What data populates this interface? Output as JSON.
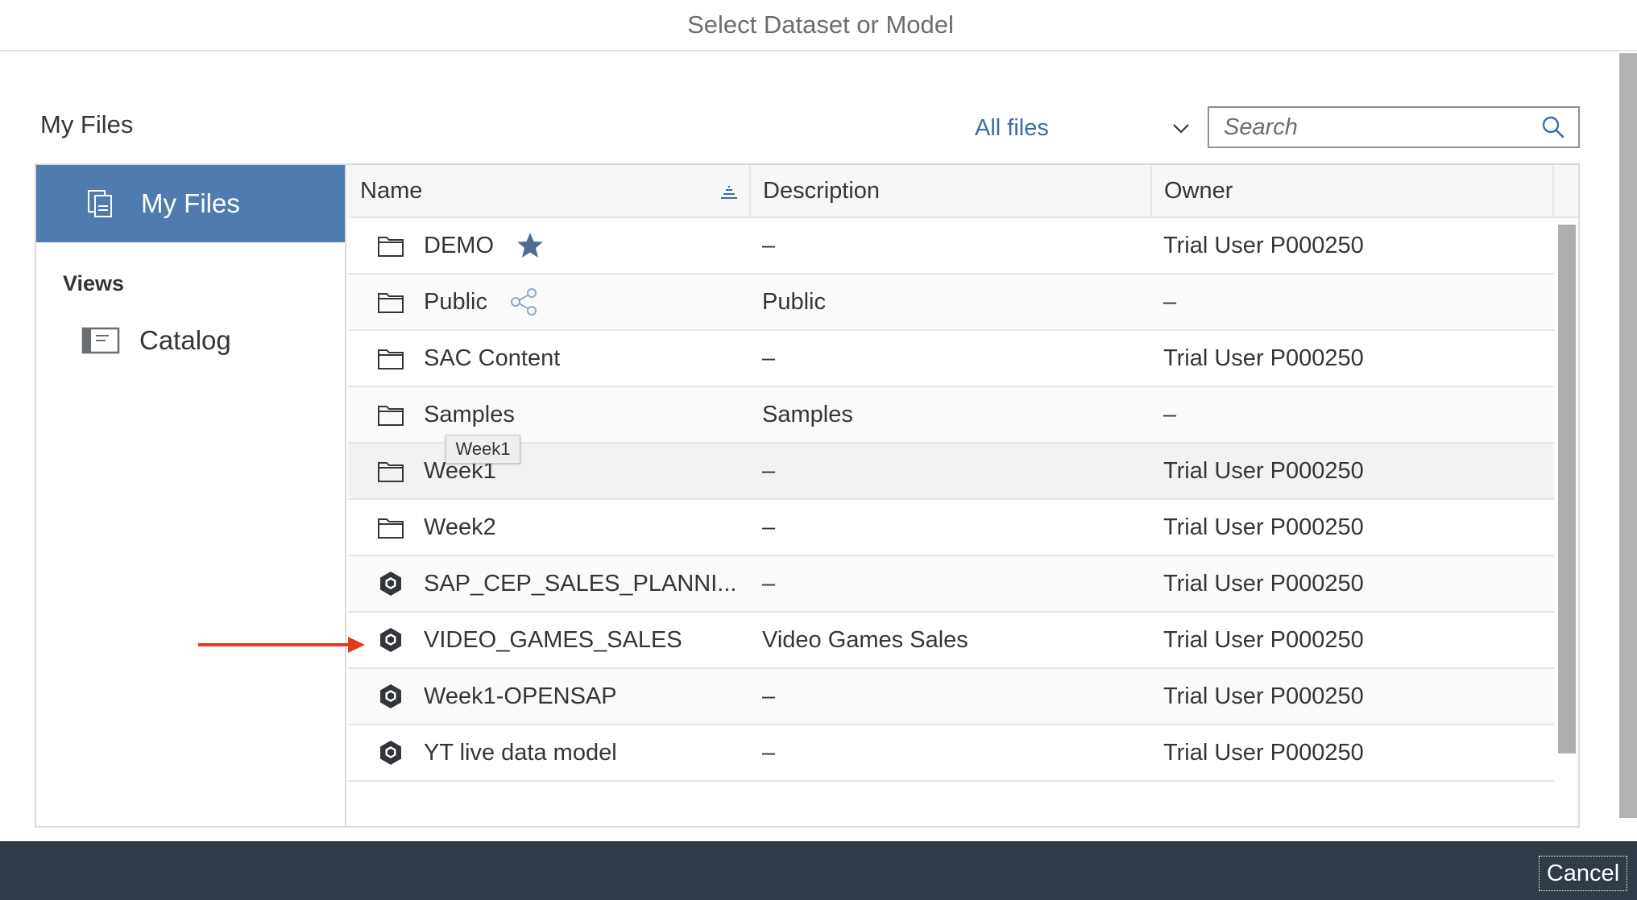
{
  "dialog": {
    "title": "Select Dataset or Model"
  },
  "section": {
    "title": "My Files"
  },
  "filter": {
    "selected": "All files"
  },
  "search": {
    "placeholder": "Search",
    "value": ""
  },
  "sidebar": {
    "active_item": "My Files",
    "views_label": "Views",
    "items": [
      {
        "label": "Catalog",
        "icon": "catalog-icon"
      }
    ]
  },
  "table": {
    "columns": {
      "name": "Name",
      "description": "Description",
      "owner": "Owner"
    },
    "rows": [
      {
        "name": "DEMO",
        "type": "folder",
        "badge": "star-icon",
        "description": "–",
        "owner": "Trial User P000250"
      },
      {
        "name": "Public",
        "type": "folder",
        "badge": "share-icon",
        "description": "Public",
        "owner": "–"
      },
      {
        "name": "SAC Content",
        "type": "folder",
        "description": "–",
        "owner": "Trial User P000250"
      },
      {
        "name": "Samples",
        "type": "folder",
        "description": "Samples",
        "owner": "–"
      },
      {
        "name": "Week1",
        "type": "folder",
        "description": "–",
        "owner": "Trial User P000250"
      },
      {
        "name": "Week2",
        "type": "folder",
        "description": "–",
        "owner": "Trial User P000250"
      },
      {
        "name": "SAP_CEP_SALES_PLANNI...",
        "type": "model",
        "description": "–",
        "owner": "Trial User P000250"
      },
      {
        "name": "VIDEO_GAMES_SALES",
        "type": "model",
        "description": "Video Games Sales",
        "owner": "Trial User P000250"
      },
      {
        "name": "Week1-OPENSAP",
        "type": "model",
        "description": "–",
        "owner": "Trial User P000250"
      },
      {
        "name": "YT live data model",
        "type": "model",
        "description": "–",
        "owner": "Trial User P000250"
      }
    ]
  },
  "tooltip": {
    "text": "Week1"
  },
  "footer": {
    "cancel_label": "Cancel"
  },
  "colors": {
    "sidebar_active": "#4f7caf",
    "footer": "#2f3c48",
    "link": "#3b6aa6",
    "annotation_arrow": "#e03a1e",
    "star": "#4f6c97"
  }
}
